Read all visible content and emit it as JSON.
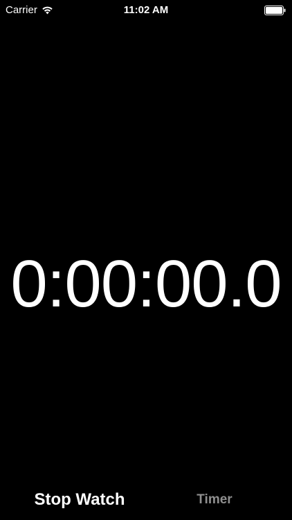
{
  "status_bar": {
    "carrier": "Carrier",
    "time": "11:02 AM",
    "wifi_icon": "wifi-icon",
    "battery_icon": "battery-icon"
  },
  "stopwatch": {
    "display": "0:00:00.0"
  },
  "tabs": [
    {
      "label": "Stop Watch",
      "selected": true
    },
    {
      "label": "Timer",
      "selected": false
    }
  ],
  "colors": {
    "background": "#000000",
    "text_primary": "#ffffff",
    "tab_inactive": "#8f8f8f"
  }
}
